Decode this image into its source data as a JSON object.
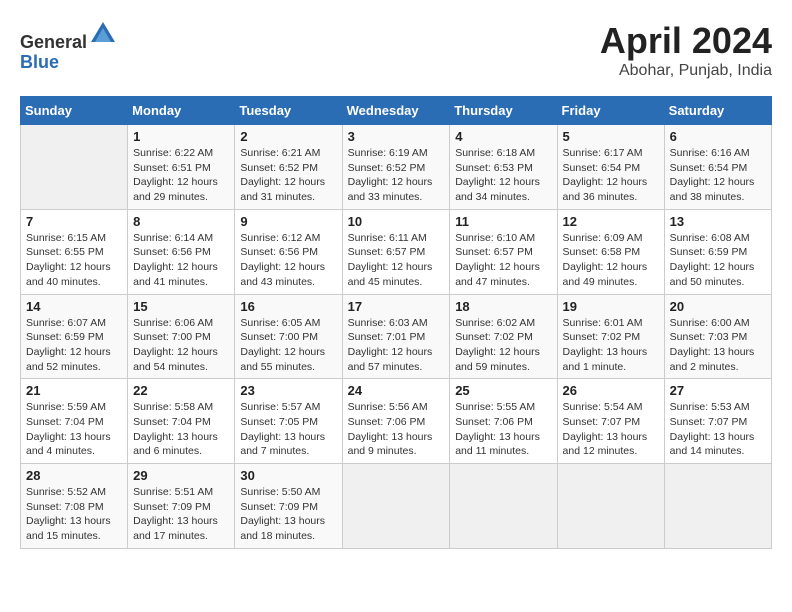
{
  "header": {
    "logo_general": "General",
    "logo_blue": "Blue",
    "month_title": "April 2024",
    "location": "Abohar, Punjab, India"
  },
  "days_of_week": [
    "Sunday",
    "Monday",
    "Tuesday",
    "Wednesday",
    "Thursday",
    "Friday",
    "Saturday"
  ],
  "weeks": [
    [
      {
        "day": "",
        "info": ""
      },
      {
        "day": "1",
        "info": "Sunrise: 6:22 AM\nSunset: 6:51 PM\nDaylight: 12 hours\nand 29 minutes."
      },
      {
        "day": "2",
        "info": "Sunrise: 6:21 AM\nSunset: 6:52 PM\nDaylight: 12 hours\nand 31 minutes."
      },
      {
        "day": "3",
        "info": "Sunrise: 6:19 AM\nSunset: 6:52 PM\nDaylight: 12 hours\nand 33 minutes."
      },
      {
        "day": "4",
        "info": "Sunrise: 6:18 AM\nSunset: 6:53 PM\nDaylight: 12 hours\nand 34 minutes."
      },
      {
        "day": "5",
        "info": "Sunrise: 6:17 AM\nSunset: 6:54 PM\nDaylight: 12 hours\nand 36 minutes."
      },
      {
        "day": "6",
        "info": "Sunrise: 6:16 AM\nSunset: 6:54 PM\nDaylight: 12 hours\nand 38 minutes."
      }
    ],
    [
      {
        "day": "7",
        "info": "Sunrise: 6:15 AM\nSunset: 6:55 PM\nDaylight: 12 hours\nand 40 minutes."
      },
      {
        "day": "8",
        "info": "Sunrise: 6:14 AM\nSunset: 6:56 PM\nDaylight: 12 hours\nand 41 minutes."
      },
      {
        "day": "9",
        "info": "Sunrise: 6:12 AM\nSunset: 6:56 PM\nDaylight: 12 hours\nand 43 minutes."
      },
      {
        "day": "10",
        "info": "Sunrise: 6:11 AM\nSunset: 6:57 PM\nDaylight: 12 hours\nand 45 minutes."
      },
      {
        "day": "11",
        "info": "Sunrise: 6:10 AM\nSunset: 6:57 PM\nDaylight: 12 hours\nand 47 minutes."
      },
      {
        "day": "12",
        "info": "Sunrise: 6:09 AM\nSunset: 6:58 PM\nDaylight: 12 hours\nand 49 minutes."
      },
      {
        "day": "13",
        "info": "Sunrise: 6:08 AM\nSunset: 6:59 PM\nDaylight: 12 hours\nand 50 minutes."
      }
    ],
    [
      {
        "day": "14",
        "info": "Sunrise: 6:07 AM\nSunset: 6:59 PM\nDaylight: 12 hours\nand 52 minutes."
      },
      {
        "day": "15",
        "info": "Sunrise: 6:06 AM\nSunset: 7:00 PM\nDaylight: 12 hours\nand 54 minutes."
      },
      {
        "day": "16",
        "info": "Sunrise: 6:05 AM\nSunset: 7:00 PM\nDaylight: 12 hours\nand 55 minutes."
      },
      {
        "day": "17",
        "info": "Sunrise: 6:03 AM\nSunset: 7:01 PM\nDaylight: 12 hours\nand 57 minutes."
      },
      {
        "day": "18",
        "info": "Sunrise: 6:02 AM\nSunset: 7:02 PM\nDaylight: 12 hours\nand 59 minutes."
      },
      {
        "day": "19",
        "info": "Sunrise: 6:01 AM\nSunset: 7:02 PM\nDaylight: 13 hours\nand 1 minute."
      },
      {
        "day": "20",
        "info": "Sunrise: 6:00 AM\nSunset: 7:03 PM\nDaylight: 13 hours\nand 2 minutes."
      }
    ],
    [
      {
        "day": "21",
        "info": "Sunrise: 5:59 AM\nSunset: 7:04 PM\nDaylight: 13 hours\nand 4 minutes."
      },
      {
        "day": "22",
        "info": "Sunrise: 5:58 AM\nSunset: 7:04 PM\nDaylight: 13 hours\nand 6 minutes."
      },
      {
        "day": "23",
        "info": "Sunrise: 5:57 AM\nSunset: 7:05 PM\nDaylight: 13 hours\nand 7 minutes."
      },
      {
        "day": "24",
        "info": "Sunrise: 5:56 AM\nSunset: 7:06 PM\nDaylight: 13 hours\nand 9 minutes."
      },
      {
        "day": "25",
        "info": "Sunrise: 5:55 AM\nSunset: 7:06 PM\nDaylight: 13 hours\nand 11 minutes."
      },
      {
        "day": "26",
        "info": "Sunrise: 5:54 AM\nSunset: 7:07 PM\nDaylight: 13 hours\nand 12 minutes."
      },
      {
        "day": "27",
        "info": "Sunrise: 5:53 AM\nSunset: 7:07 PM\nDaylight: 13 hours\nand 14 minutes."
      }
    ],
    [
      {
        "day": "28",
        "info": "Sunrise: 5:52 AM\nSunset: 7:08 PM\nDaylight: 13 hours\nand 15 minutes."
      },
      {
        "day": "29",
        "info": "Sunrise: 5:51 AM\nSunset: 7:09 PM\nDaylight: 13 hours\nand 17 minutes."
      },
      {
        "day": "30",
        "info": "Sunrise: 5:50 AM\nSunset: 7:09 PM\nDaylight: 13 hours\nand 18 minutes."
      },
      {
        "day": "",
        "info": ""
      },
      {
        "day": "",
        "info": ""
      },
      {
        "day": "",
        "info": ""
      },
      {
        "day": "",
        "info": ""
      }
    ]
  ]
}
